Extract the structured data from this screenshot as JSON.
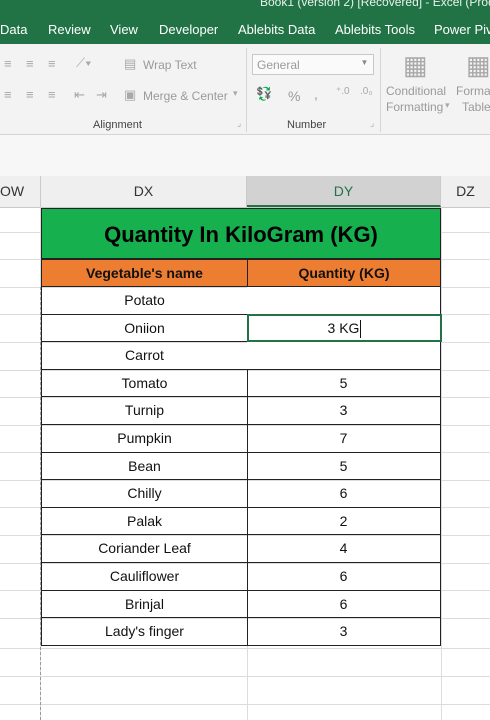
{
  "window": {
    "title": "Book1 (version 2) [Recovered] - Excel (Prod"
  },
  "menu": [
    "Data",
    "Review",
    "View",
    "Developer",
    "Ablebits Data",
    "Ablebits Tools",
    "Power Pivo"
  ],
  "ribbon": {
    "wrap_text": "Wrap Text",
    "merge_center": "Merge & Center",
    "alignment_group": "Alignment",
    "number_format": "General",
    "percent": "%",
    "comma": ",",
    "number_group": "Number",
    "conditional_formatting_1": "Conditional",
    "conditional_formatting_2": "Formatting",
    "format_table_1": "Forma",
    "format_table_2": "Table"
  },
  "columns": [
    "OW",
    "DX",
    "DY",
    "DZ"
  ],
  "table": {
    "title": "Quantity In KiloGram (KG)",
    "headers": [
      "Vegetable's name",
      "Quantity (KG)"
    ],
    "rows": [
      {
        "name": "Potato",
        "qty": ""
      },
      {
        "name": "Oniion",
        "qty": ""
      },
      {
        "name": "Carrot",
        "qty": ""
      },
      {
        "name": "Tomato",
        "qty": "5"
      },
      {
        "name": "Turnip",
        "qty": "3"
      },
      {
        "name": "Pumpkin",
        "qty": "7"
      },
      {
        "name": "Bean",
        "qty": "5"
      },
      {
        "name": "Chilly",
        "qty": "6"
      },
      {
        "name": "Palak",
        "qty": "2"
      },
      {
        "name": "Coriander Leaf",
        "qty": "4"
      },
      {
        "name": "Cauliflower",
        "qty": "6"
      },
      {
        "name": "Brinjal",
        "qty": "6"
      },
      {
        "name": "Lady's finger",
        "qty": "3"
      }
    ],
    "editing_value": "3 KG"
  },
  "colors": {
    "excel_green": "#217346",
    "title_fill": "#16b04f",
    "header_fill": "#ed7d31"
  }
}
